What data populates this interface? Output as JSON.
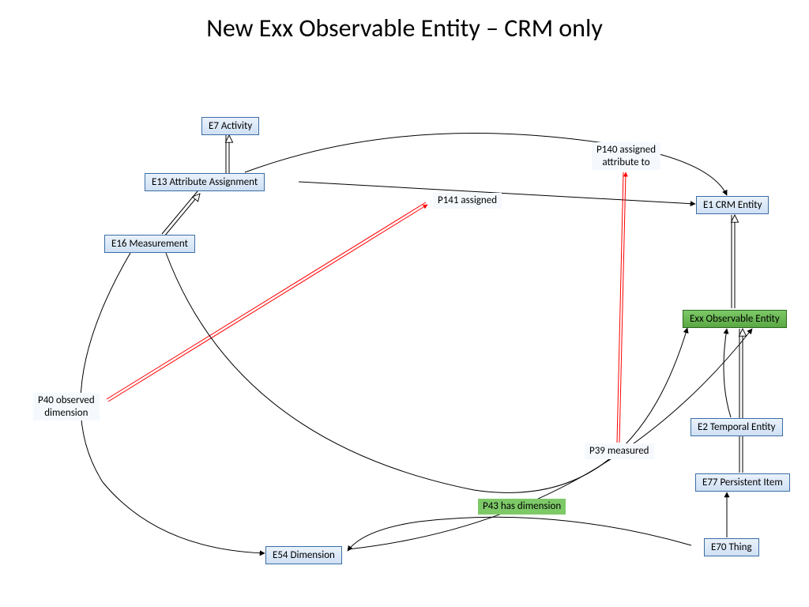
{
  "title": "New Exx Observable Entity – CRM only",
  "nodes": {
    "e7": "E7 Activity",
    "e13": "E13 Attribute Assignment",
    "e16": "E16 Measurement",
    "e1": "E1 CRM Entity",
    "exx": "Exx Observable Entity",
    "e2": "E2 Temporal Entity",
    "e77": "E77 Persistent Item",
    "e70": "E70 Thing",
    "e54": "E54 Dimension"
  },
  "labels": {
    "p140": "P140 assigned\nattribute to",
    "p141": "P141 assigned",
    "p40": "P40 observed\ndimension",
    "p39": "P39 measured",
    "p43": "P43  has dimension"
  }
}
